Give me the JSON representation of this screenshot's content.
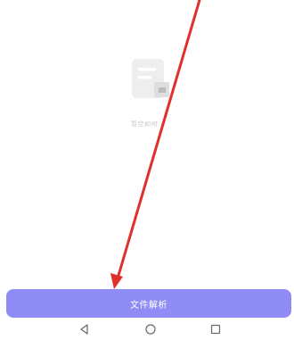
{
  "empty_state": {
    "icon": "document-icon",
    "text": "暂空如何"
  },
  "primary_button": {
    "label": "文件解析",
    "color": "#8f8cf6"
  },
  "nav_bar": {
    "back": "back-triangle-icon",
    "home": "home-circle-icon",
    "recents": "recents-square-icon"
  },
  "annotation": {
    "color": "#e0302c"
  }
}
